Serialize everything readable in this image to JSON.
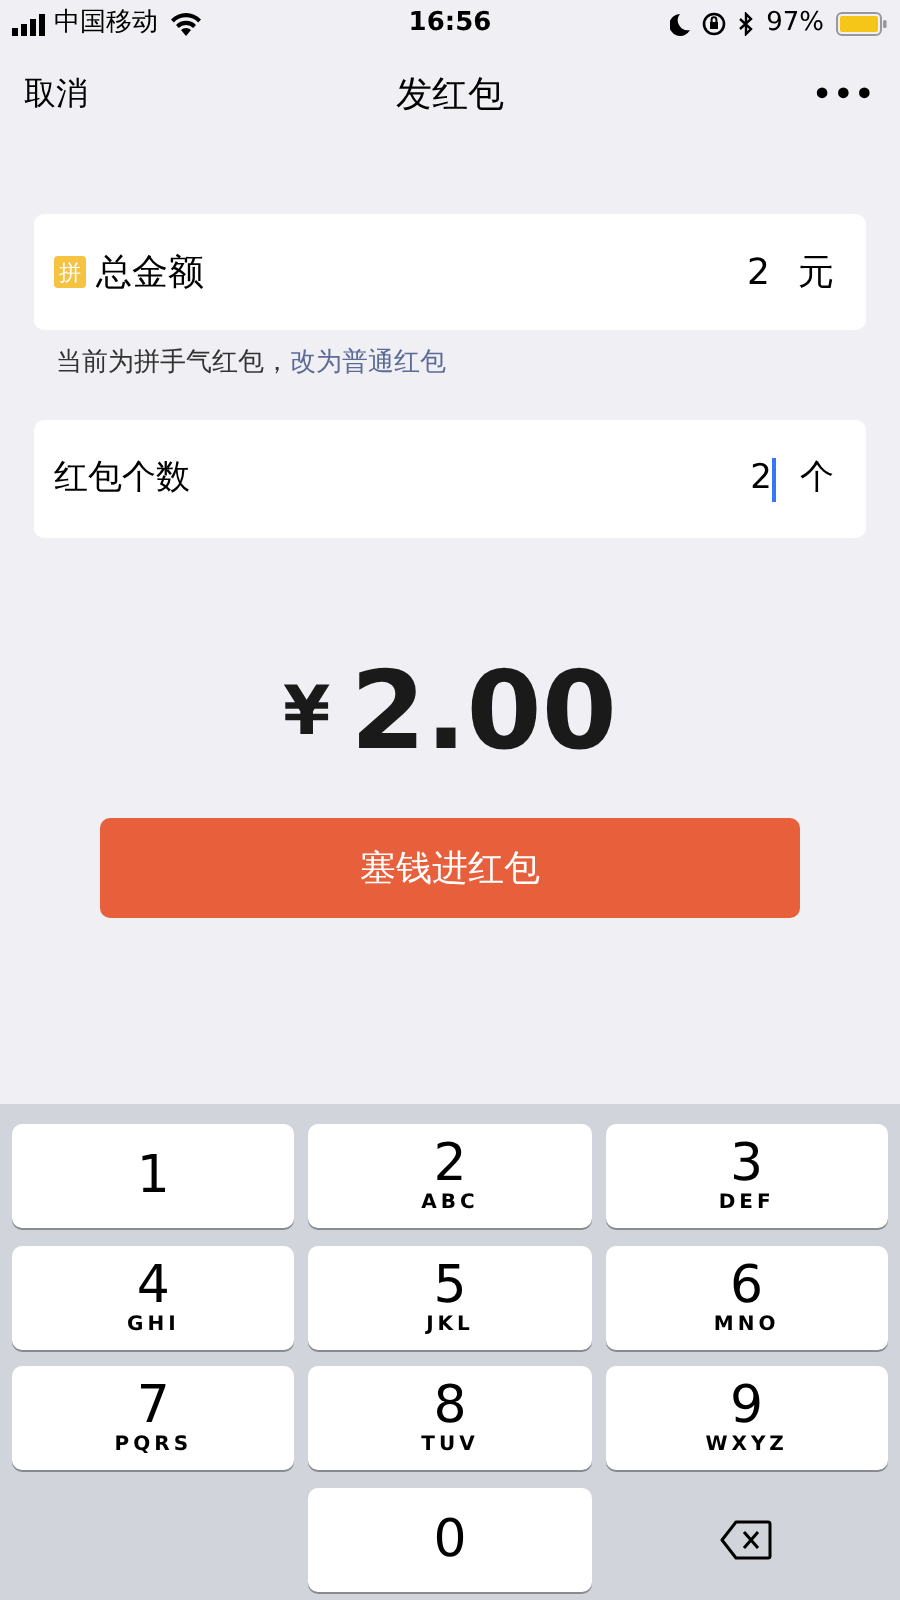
{
  "status_bar": {
    "carrier": "中国移动",
    "time": "16:56",
    "battery": "97%"
  },
  "nav": {
    "cancel": "取消",
    "title": "发红包",
    "more": "•••"
  },
  "amount_field": {
    "badge": "拼",
    "label": "总金额",
    "value": "2",
    "unit": "元"
  },
  "hint": {
    "text": "当前为拼手气红包，",
    "link": "改为普通红包"
  },
  "count_field": {
    "label": "红包个数",
    "value": "2",
    "unit": "个",
    "focused": true
  },
  "total": {
    "currency": "¥",
    "amount": "2.00"
  },
  "submit": {
    "label": "塞钱进红包"
  },
  "keys": [
    {
      "kind": "digit",
      "digit": "1"
    },
    {
      "kind": "digit",
      "digit": "2",
      "letters": "ABC"
    },
    {
      "kind": "digit",
      "digit": "3",
      "letters": "DEF"
    },
    {
      "kind": "digit",
      "digit": "4",
      "letters": "GHI"
    },
    {
      "kind": "digit",
      "digit": "5",
      "letters": "JKL"
    },
    {
      "kind": "digit",
      "digit": "6",
      "letters": "MNO"
    },
    {
      "kind": "digit",
      "digit": "7",
      "letters": "PQRS"
    },
    {
      "kind": "digit",
      "digit": "8",
      "letters": "TUV"
    },
    {
      "kind": "digit",
      "digit": "9",
      "letters": "WXYZ"
    },
    {
      "kind": "blank"
    },
    {
      "kind": "digit",
      "digit": "0"
    },
    {
      "kind": "delete"
    }
  ]
}
